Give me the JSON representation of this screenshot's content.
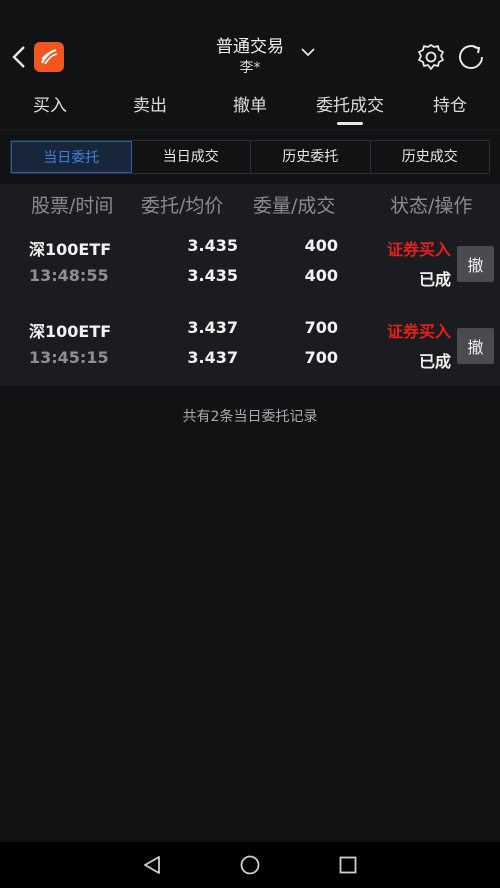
{
  "title": {
    "main": "普通交易",
    "sub": "李*"
  },
  "main_tabs": [
    "买入",
    "卖出",
    "撤单",
    "委托成交",
    "持仓"
  ],
  "sub_tabs": [
    "当日委托",
    "当日成交",
    "历史委托",
    "历史成交"
  ],
  "columns": [
    "股票/时间",
    "委托/均价",
    "委量/成交",
    "状态/操作"
  ],
  "orders": [
    {
      "code": "深100ETF",
      "time": "13:48:55",
      "order_price": "3.435",
      "avg_price": "3.435",
      "order_qty": "400",
      "filled_qty": "400",
      "type": "证券买入",
      "state": "已成",
      "cancel": "撤"
    },
    {
      "code": "深100ETF",
      "time": "13:45:15",
      "order_price": "3.437",
      "avg_price": "3.437",
      "order_qty": "700",
      "filled_qty": "700",
      "type": "证券买入",
      "state": "已成",
      "cancel": "撤"
    }
  ],
  "footer_note": "共有2条当日委托记录",
  "colors": {
    "accent_blue": "#3c82dc",
    "buy_red": "#e3201b",
    "logo_orange": "#f0561e"
  },
  "icons": [
    "back-icon",
    "app-logo-icon",
    "chevron-down-icon",
    "gear-icon",
    "refresh-icon",
    "nav-back-icon",
    "nav-home-icon",
    "nav-recents-icon"
  ]
}
